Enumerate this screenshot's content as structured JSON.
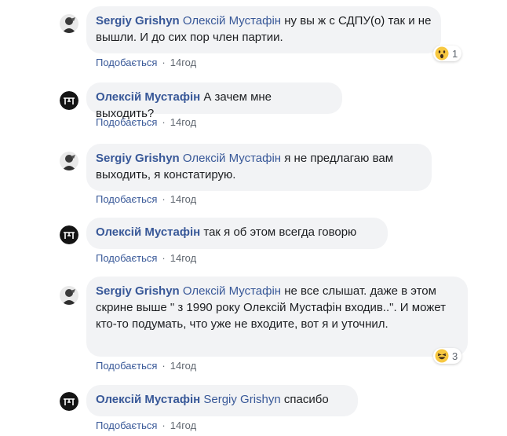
{
  "comments": [
    {
      "author": "Sergiy Grishyn",
      "mention": "Олексій Мустафін",
      "text": " ну вы ж с СДПУ(о) так и не вышли. И до сих пор член партии.",
      "like": "Подобається",
      "time": "14год",
      "reaction": {
        "icon": "wow-emoji-icon",
        "count": "1"
      }
    },
    {
      "author": "Олексій Мустафін",
      "mention": "",
      "text": "А зачем мне выходить?",
      "like": "Подобається",
      "time": "14год"
    },
    {
      "author": "Sergiy Grishyn",
      "mention": "Олексій Мустафін",
      "text": " я не предлагаю вам выходить, я констатирую.",
      "like": "Подобається",
      "time": "14год"
    },
    {
      "author": "Олексій Мустафін",
      "mention": "",
      "text": "так я об этом всегда говорю",
      "like": "Подобається",
      "time": "14год"
    },
    {
      "author": "Sergiy Grishyn",
      "mention": "Олексій Мустафін",
      "text": " не все слышат. даже в этом скрине выше \" з 1990 року Олексій Мустафін входив..\". И может кто-то подумать, что уже не входите, вот я и уточнил.",
      "like": "Подобається",
      "time": "14год",
      "reaction": {
        "icon": "haha-emoji-icon",
        "count": "3"
      }
    },
    {
      "author": "Олексій Мустафін",
      "mention": "Sergiy Grishyn",
      "text": " спасибо",
      "like": "Подобається",
      "time": "14год"
    }
  ],
  "colors": {
    "link": "#385898",
    "bubble": "#f2f3f5",
    "meta": "#606770"
  }
}
